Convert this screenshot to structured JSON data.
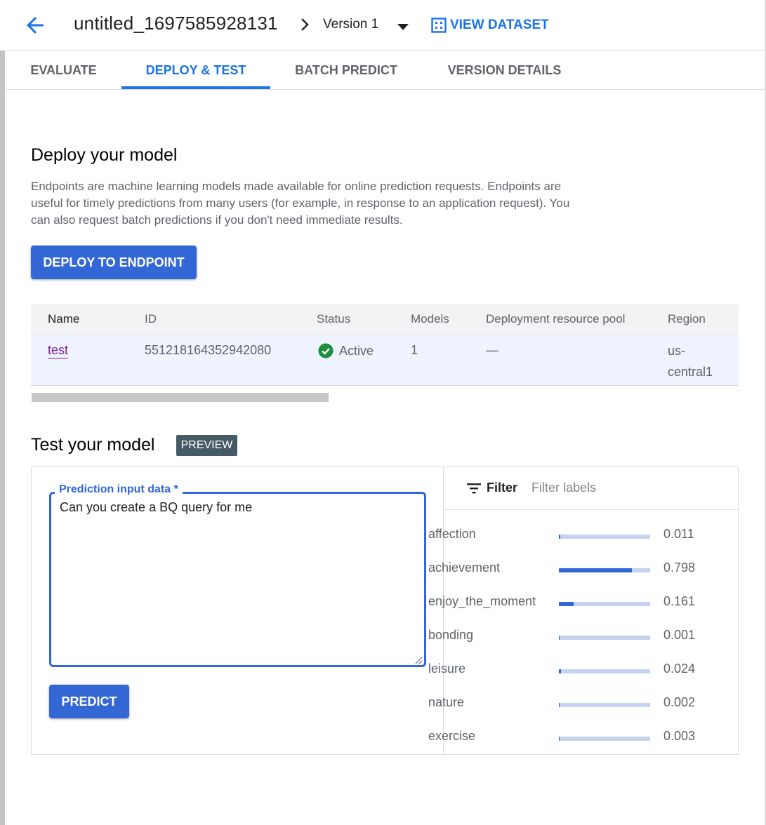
{
  "header": {
    "title": "untitled_1697585928131",
    "version": "Version 1",
    "view_dataset": "VIEW DATASET"
  },
  "tabs": [
    {
      "label": "EVALUATE"
    },
    {
      "label": "DEPLOY & TEST",
      "active": true
    },
    {
      "label": "BATCH PREDICT"
    },
    {
      "label": "VERSION DETAILS"
    }
  ],
  "deploy": {
    "title": "Deploy your model",
    "description": "Endpoints are machine learning models made available for online prediction requests. Endpoints are useful for timely predictions from many users (for example, in response to an application request). You can also request batch predictions if you don't need immediate results.",
    "button": "DEPLOY TO ENDPOINT"
  },
  "endpoints_table": {
    "columns": [
      "Name",
      "ID",
      "Status",
      "Models",
      "Deployment resource pool",
      "Region"
    ],
    "rows": [
      {
        "name": "test",
        "id": "551218164352942080",
        "status": "Active",
        "models": "1",
        "pool": "—",
        "region": "us-\ncentral1"
      }
    ]
  },
  "test": {
    "title": "Test your model",
    "badge": "PREVIEW",
    "input_label": "Prediction input data *",
    "input_value": "Can you create a BQ query for me",
    "predict_button": "PREDICT",
    "filter_label": "Filter",
    "filter_placeholder": "Filter labels",
    "labels": [
      {
        "name": "affection",
        "value": "0.011",
        "score": 0.011
      },
      {
        "name": "achievement",
        "value": "0.798",
        "score": 0.798
      },
      {
        "name": "enjoy_the_moment",
        "value": "0.161",
        "score": 0.161
      },
      {
        "name": "bonding",
        "value": "0.001",
        "score": 0.001
      },
      {
        "name": "leisure",
        "value": "0.024",
        "score": 0.024
      },
      {
        "name": "nature",
        "value": "0.002",
        "score": 0.002
      },
      {
        "name": "exercise",
        "value": "0.003",
        "score": 0.003
      }
    ]
  },
  "colors": {
    "accent": "#1a73e8",
    "button": "#3367d6",
    "status_active": "#1e8e3e",
    "link_visited": "#7b1fa2"
  },
  "icons": [
    "arrow-back-icon",
    "chevron-right-icon",
    "dropdown-caret-icon",
    "grid-icon",
    "check-circle-icon",
    "filter-icon",
    "resize-handle-icon"
  ]
}
